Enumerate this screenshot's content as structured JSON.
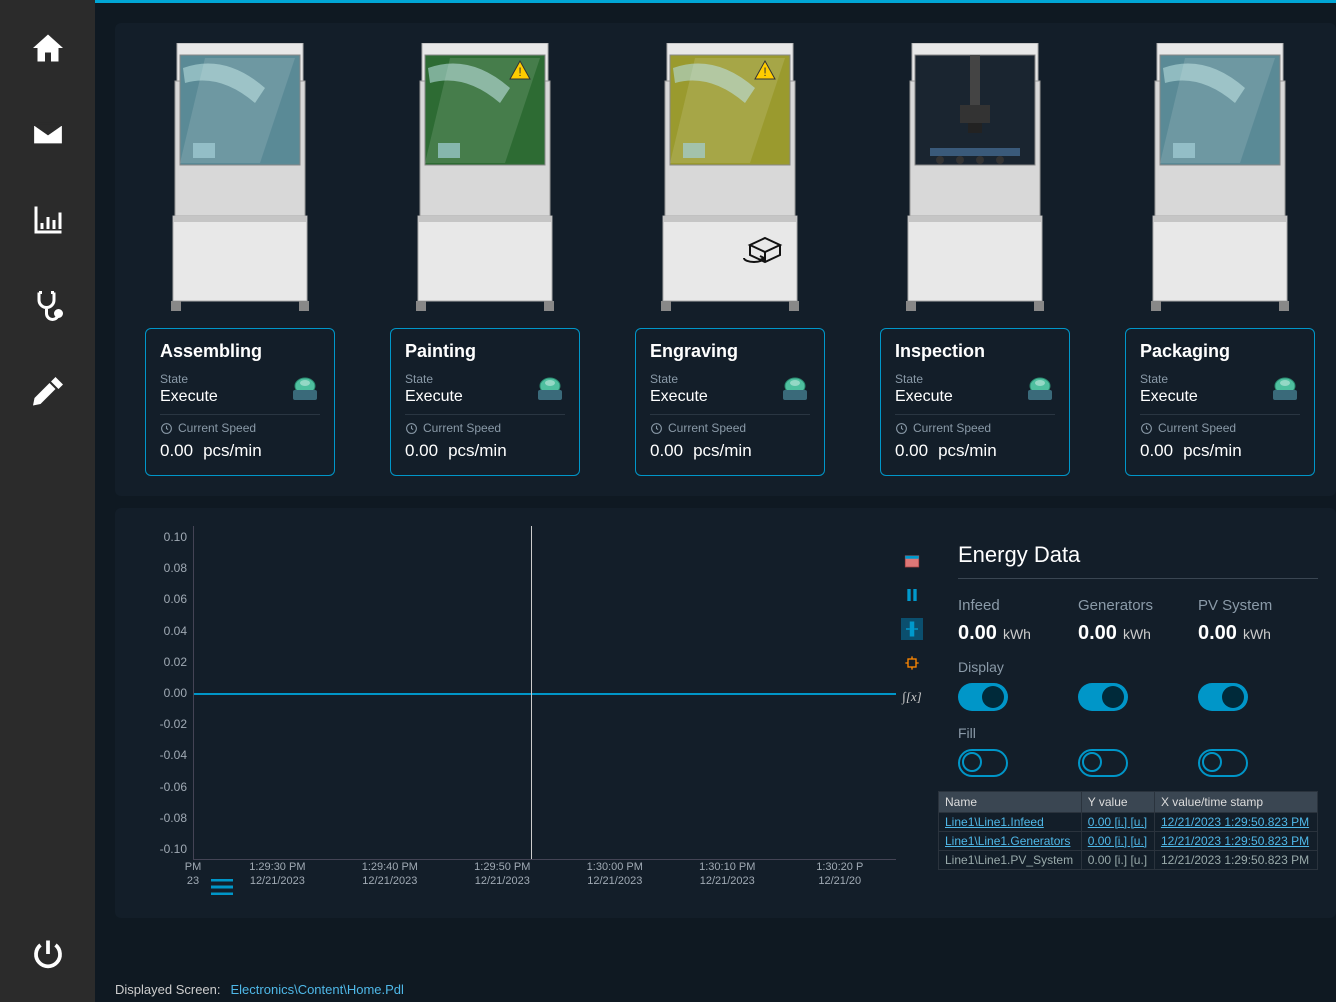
{
  "sidebar": {
    "icons": [
      "home",
      "mail",
      "chart",
      "diagnostics",
      "settings",
      "power"
    ]
  },
  "machines": [
    {
      "name": "Assembling",
      "state_label": "State",
      "state": "Execute",
      "speed_label": "Current Speed",
      "speed": "0.00",
      "unit": "pcs/min",
      "window_color": "#5a8a96",
      "warning": false,
      "type": "arm"
    },
    {
      "name": "Painting",
      "state_label": "State",
      "state": "Execute",
      "speed_label": "Current Speed",
      "speed": "0.00",
      "unit": "pcs/min",
      "window_color": "#2d6b33",
      "warning": true,
      "type": "arm"
    },
    {
      "name": "Engraving",
      "state_label": "State",
      "state": "Execute",
      "speed_label": "Current Speed",
      "speed": "0.00",
      "unit": "pcs/min",
      "window_color": "#9a9a2e",
      "warning": true,
      "type": "arm",
      "cube": true
    },
    {
      "name": "Inspection",
      "state_label": "State",
      "state": "Execute",
      "speed_label": "Current Speed",
      "speed": "0.00",
      "unit": "pcs/min",
      "window_color": "#1a2530",
      "warning": false,
      "type": "camera"
    },
    {
      "name": "Packaging",
      "state_label": "State",
      "state": "Execute",
      "speed_label": "Current Speed",
      "speed": "0.00",
      "unit": "pcs/min",
      "window_color": "#5a8a96",
      "warning": false,
      "type": "arm"
    }
  ],
  "chart_data": {
    "type": "line",
    "title": "",
    "ylim": [
      -0.1,
      0.1
    ],
    "y_ticks": [
      "0.10",
      "0.08",
      "0.06",
      "0.04",
      "0.02",
      "0.00",
      "-0.02",
      "-0.04",
      "-0.06",
      "-0.08",
      "-0.10"
    ],
    "x_ticks": [
      {
        "pos": 0,
        "time": "PM",
        "date": "23"
      },
      {
        "pos": 12,
        "time": "1:29:30 PM",
        "date": "12/21/2023"
      },
      {
        "pos": 28,
        "time": "1:29:40 PM",
        "date": "12/21/2023"
      },
      {
        "pos": 44,
        "time": "1:29:50 PM",
        "date": "12/21/2023"
      },
      {
        "pos": 60,
        "time": "1:30:00 PM",
        "date": "12/21/2023"
      },
      {
        "pos": 76,
        "time": "1:30:10 PM",
        "date": "12/21/2023"
      },
      {
        "pos": 92,
        "time": "1:30:20 P",
        "date": "12/21/20"
      }
    ],
    "series": [
      {
        "name": "Line1\\Line1.Infeed",
        "values": [
          0
        ]
      },
      {
        "name": "Line1\\Line1.Generators",
        "values": [
          0
        ]
      },
      {
        "name": "Line1\\Line1.PV_System",
        "values": [
          0
        ]
      }
    ]
  },
  "chart_tools": [
    "timerange",
    "pause",
    "ruler",
    "crosshair",
    "integral"
  ],
  "energy": {
    "title": "Energy Data",
    "columns": [
      {
        "label": "Infeed",
        "value": "0.00",
        "unit": "kWh",
        "display": true,
        "fill": false
      },
      {
        "label": "Generators",
        "value": "0.00",
        "unit": "kWh",
        "display": true,
        "fill": false
      },
      {
        "label": "PV System",
        "value": "0.00",
        "unit": "kWh",
        "display": true,
        "fill": false
      }
    ],
    "display_label": "Display",
    "fill_label": "Fill",
    "table": {
      "headers": [
        "Name",
        "Y value",
        "X value/time stamp"
      ],
      "rows": [
        {
          "name": "Line1\\Line1.Infeed",
          "y": "0.00 [i.] [u.]",
          "x": "12/21/2023 1:29:50.823 PM",
          "link": true
        },
        {
          "name": "Line1\\Line1.Generators",
          "y": "0.00 [i.] [u.]",
          "x": "12/21/2023 1:29:50.823 PM",
          "link": true
        },
        {
          "name": "Line1\\Line1.PV_System",
          "y": "0.00 [i.] [u.]",
          "x": "12/21/2023 1:29:50.823 PM",
          "link": false
        }
      ]
    }
  },
  "footer": {
    "label": "Displayed Screen:",
    "path": "Electronics\\Content\\Home.Pdl"
  }
}
